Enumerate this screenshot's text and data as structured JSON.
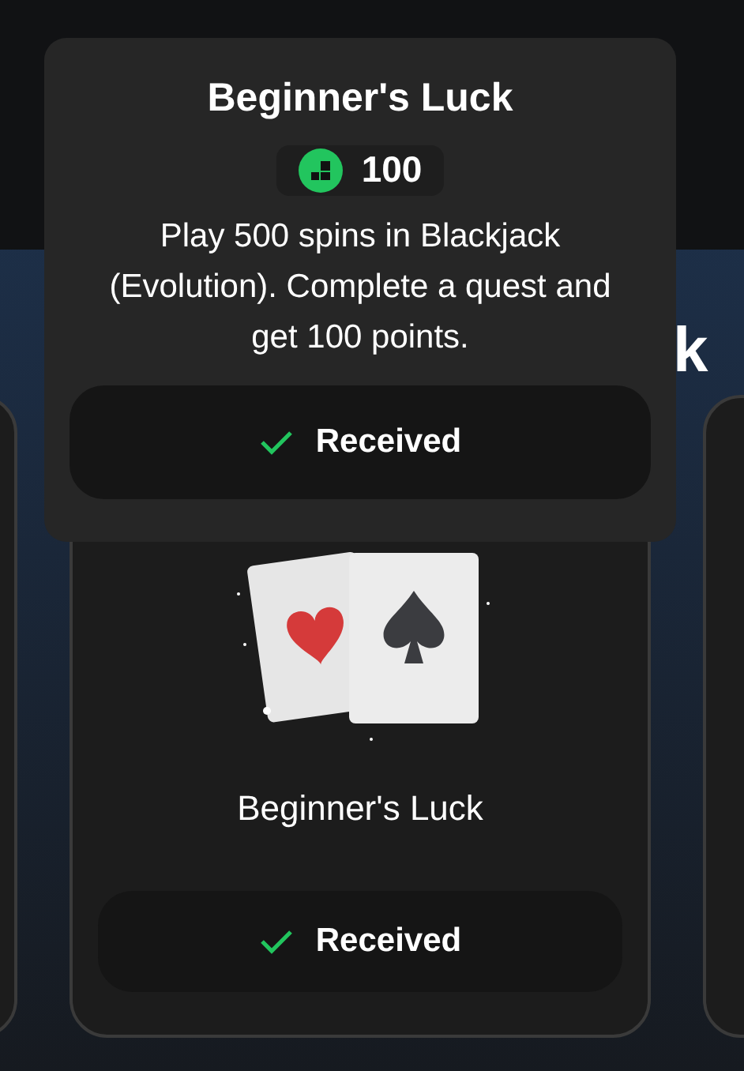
{
  "heading": "k",
  "quest_card": {
    "title": "Beginner's Luck",
    "status": {
      "label": "Received",
      "received": true
    }
  },
  "tooltip": {
    "title": "Beginner's Luck",
    "points": "100",
    "description": "Play 500 spins in Blackjack (Evolution). Complete a quest and get 100 points.",
    "status": {
      "label": "Received",
      "received": true
    }
  }
}
